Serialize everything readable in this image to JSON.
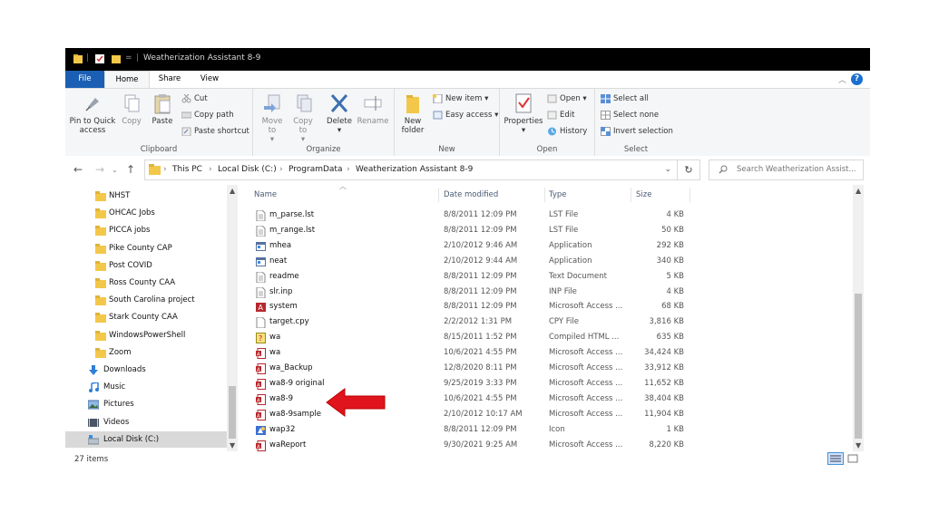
{
  "window": {
    "title": "Weatherization Assistant 8-9",
    "background": "#000000"
  },
  "tabs": {
    "file": "File",
    "home": "Home",
    "share": "Share",
    "view": "View"
  },
  "ribbon": {
    "clipboard": {
      "label": "Clipboard",
      "pin": "Pin to Quick access",
      "copy": "Copy",
      "paste": "Paste",
      "cut": "Cut",
      "copy_path": "Copy path",
      "paste_shortcut": "Paste shortcut"
    },
    "organize": {
      "label": "Organize",
      "move_to": "Move to",
      "copy_to": "Copy to",
      "delete": "Delete",
      "rename": "Rename"
    },
    "new": {
      "label": "New",
      "new_folder": "New folder",
      "new_item": "New item",
      "easy_access": "Easy access"
    },
    "open": {
      "label": "Open",
      "properties": "Properties",
      "open": "Open",
      "edit": "Edit",
      "history": "History"
    },
    "select": {
      "label": "Select",
      "select_all": "Select all",
      "select_none": "Select none",
      "invert": "Invert selection"
    }
  },
  "address": {
    "crumbs": [
      "This PC",
      "Local Disk (C:)",
      "ProgramData",
      "Weatherization Assistant 8-9"
    ],
    "search_placeholder": "Search Weatherization Assist..."
  },
  "nav": [
    {
      "label": "NHST",
      "icon": "folder-icon"
    },
    {
      "label": "OHCAC Jobs",
      "icon": "folder-icon"
    },
    {
      "label": "PICCA jobs",
      "icon": "folder-icon"
    },
    {
      "label": "Pike County CAP",
      "icon": "folder-icon"
    },
    {
      "label": "Post COVID",
      "icon": "folder-icon"
    },
    {
      "label": "Ross County CAA",
      "icon": "folder-icon"
    },
    {
      "label": "South Carolina project",
      "icon": "folder-icon"
    },
    {
      "label": "Stark County CAA",
      "icon": "folder-icon"
    },
    {
      "label": "WindowsPowerShell",
      "icon": "folder-icon"
    },
    {
      "label": "Zoom",
      "icon": "folder-icon"
    },
    {
      "label": "Downloads",
      "icon": "downloads-icon"
    },
    {
      "label": "Music",
      "icon": "music-icon"
    },
    {
      "label": "Pictures",
      "icon": "pictures-icon"
    },
    {
      "label": "Videos",
      "icon": "videos-icon"
    },
    {
      "label": "Local Disk (C:)",
      "icon": "drive-icon",
      "selected": true
    }
  ],
  "columns": {
    "name": "Name",
    "date": "Date modified",
    "type": "Type",
    "size": "Size"
  },
  "files": [
    {
      "name": "m_parse.lst",
      "date": "8/8/2011 12:09 PM",
      "type": "LST File",
      "size": "4 KB",
      "icon": "text-file-icon"
    },
    {
      "name": "m_range.lst",
      "date": "8/8/2011 12:09 PM",
      "type": "LST File",
      "size": "50 KB",
      "icon": "text-file-icon"
    },
    {
      "name": "mhea",
      "date": "2/10/2012 9:46 AM",
      "type": "Application",
      "size": "292 KB",
      "icon": "application-icon"
    },
    {
      "name": "neat",
      "date": "2/10/2012 9:44 AM",
      "type": "Application",
      "size": "340 KB",
      "icon": "application-icon"
    },
    {
      "name": "readme",
      "date": "8/8/2011 12:09 PM",
      "type": "Text Document",
      "size": "5 KB",
      "icon": "text-file-icon"
    },
    {
      "name": "slr.inp",
      "date": "8/8/2011 12:09 PM",
      "type": "INP File",
      "size": "4 KB",
      "icon": "text-file-icon"
    },
    {
      "name": "system",
      "date": "8/8/2011 12:09 PM",
      "type": "Microsoft Access ...",
      "size": "68 KB",
      "icon": "access-icon"
    },
    {
      "name": "target.cpy",
      "date": "2/2/2012 1:31 PM",
      "type": "CPY File",
      "size": "3,816 KB",
      "icon": "blank-file-icon"
    },
    {
      "name": "wa",
      "date": "8/15/2011 1:52 PM",
      "type": "Compiled HTML ...",
      "size": "635 KB",
      "icon": "help-file-icon"
    },
    {
      "name": "wa",
      "date": "10/6/2021 4:55 PM",
      "type": "Microsoft Access ...",
      "size": "34,424 KB",
      "icon": "access-db-icon"
    },
    {
      "name": "wa_Backup",
      "date": "12/8/2020 8:11 PM",
      "type": "Microsoft Access ...",
      "size": "33,912 KB",
      "icon": "access-db-icon"
    },
    {
      "name": "wa8-9 original",
      "date": "9/25/2019 3:33 PM",
      "type": "Microsoft Access ...",
      "size": "11,652 KB",
      "icon": "access-db-icon"
    },
    {
      "name": "wa8-9",
      "date": "10/6/2021 4:55 PM",
      "type": "Microsoft Access ...",
      "size": "38,404 KB",
      "icon": "access-db-icon"
    },
    {
      "name": "wa8-9sample",
      "date": "2/10/2012 10:17 AM",
      "type": "Microsoft Access ...",
      "size": "11,904 KB",
      "icon": "access-db-icon"
    },
    {
      "name": "wap32",
      "date": "8/8/2011 12:09 PM",
      "type": "Icon",
      "size": "1 KB",
      "icon": "icon-file-icon"
    },
    {
      "name": "waReport",
      "date": "9/30/2021 9:25 AM",
      "type": "Microsoft Access ...",
      "size": "8,220 KB",
      "icon": "access-db-icon"
    }
  ],
  "status": {
    "items": "27 items"
  },
  "colors": {
    "accent": "#1a5fb4",
    "folder": "#f3c84a",
    "arrow": "#e0141c",
    "access": "#b7282e"
  }
}
